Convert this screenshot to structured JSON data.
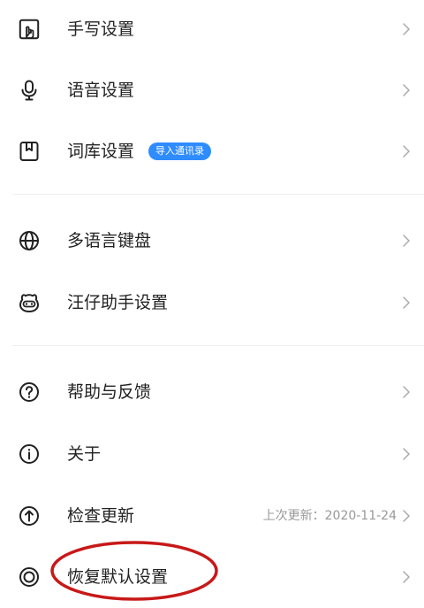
{
  "colors": {
    "text": "#222222",
    "muted": "#999999",
    "divider": "#eeeeee",
    "badge": "#2f8cff",
    "annotation": "#c81818"
  },
  "sections": [
    {
      "items": [
        {
          "label": "手写设置",
          "icon": "handwriting-icon"
        },
        {
          "label": "语音设置",
          "icon": "microphone-icon"
        },
        {
          "label": "词库设置",
          "icon": "dictionary-icon",
          "badge": "导入通讯录"
        }
      ]
    },
    {
      "items": [
        {
          "label": "多语言键盘",
          "icon": "globe-icon"
        },
        {
          "label": "汪仔助手设置",
          "icon": "dog-assistant-icon"
        }
      ]
    },
    {
      "items": [
        {
          "label": "帮助与反馈",
          "icon": "help-icon"
        },
        {
          "label": "关于",
          "icon": "info-icon"
        },
        {
          "label": "检查更新",
          "icon": "update-icon",
          "meta": "上次更新：2020-11-24"
        },
        {
          "label": "恢复默认设置",
          "icon": "restore-default-icon"
        }
      ]
    }
  ],
  "chevron_icon": "chevron-right-icon",
  "annotation_icon": "red-circle-annotation"
}
